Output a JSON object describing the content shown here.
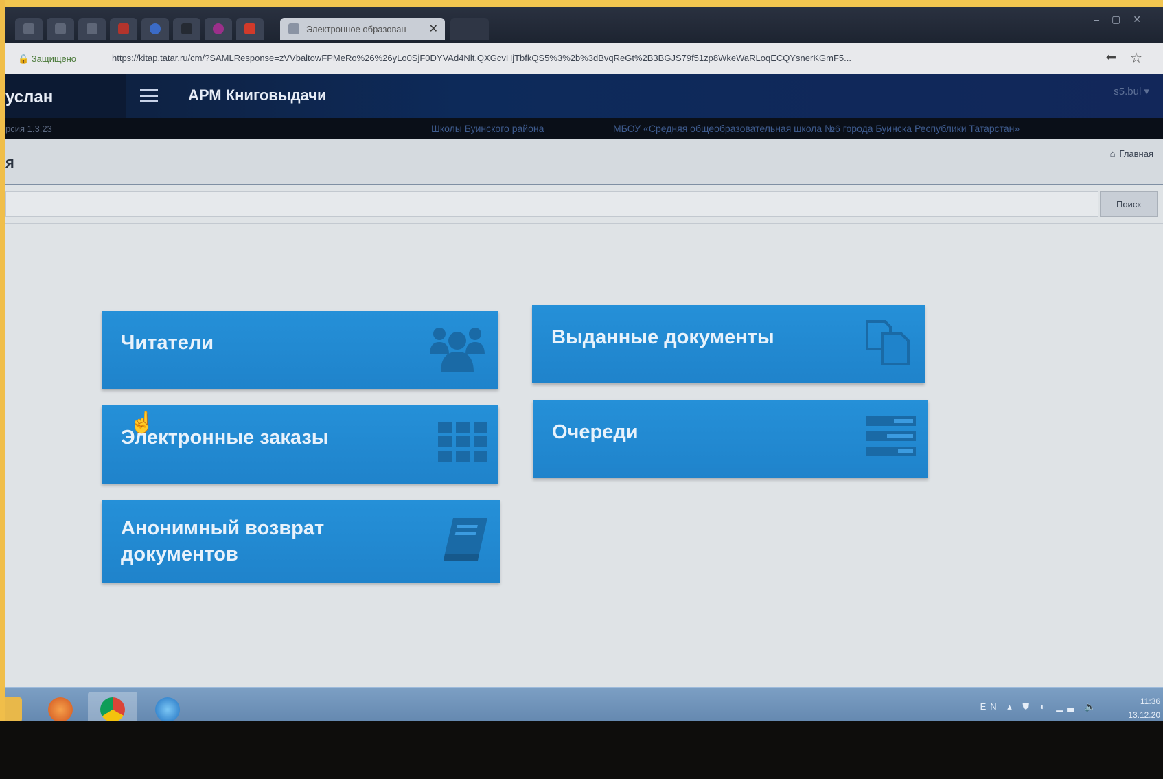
{
  "browser": {
    "tabs": [
      {
        "label": ""
      },
      {
        "label": ""
      },
      {
        "label": ""
      },
      {
        "label": ""
      },
      {
        "label": ""
      },
      {
        "label": ""
      },
      {
        "label": ""
      },
      {
        "label": ""
      },
      {
        "label": "Электронное образован",
        "close": "✕"
      }
    ],
    "window_controls": "–▢✕",
    "secure_label": "🔒 Защищено",
    "url": "https://kitap.tatar.ru/cm/?SAMLResponse=zVVbaltowFPMeRo%26%26yLo0SjF0DYVAd4Nlt.QXGcvHjTbfkQS5%3%2b%3dBvqReGt%2B3BGJS79f51zp8WkeWaRLoqECQYsnerKGmF5..."
  },
  "app": {
    "brand": "услан",
    "title": "АРМ Книговыдачи",
    "user_menu": "s5.bul ▾",
    "version": "рсия 1.3.23",
    "district": "Школы Буинского района",
    "school": "МБОУ «Средняя общеобразовательная школа №6 города Буинска Республики Татарстан»"
  },
  "page": {
    "title": "я",
    "home_link": "Главная",
    "search": {
      "placeholder": "",
      "button": "Поиск"
    }
  },
  "tiles": {
    "readers": {
      "label": "Читатели",
      "icon": "users-icon"
    },
    "issued": {
      "label": "Выданные документы",
      "icon": "copy-documents-icon"
    },
    "orders": {
      "label": "Электронные заказы",
      "icon": "grid-icon"
    },
    "queues": {
      "label": "Очереди",
      "icon": "list-icon"
    },
    "anon_return": {
      "label": "Анонимный возврат документов",
      "icon": "book-icon"
    }
  },
  "taskbar": {
    "language": "EN",
    "time": "11:36",
    "date": "13.12.20"
  },
  "colors": {
    "tile": "#2590d8",
    "header": "#0d2a5a",
    "frame": "#f3c650"
  }
}
